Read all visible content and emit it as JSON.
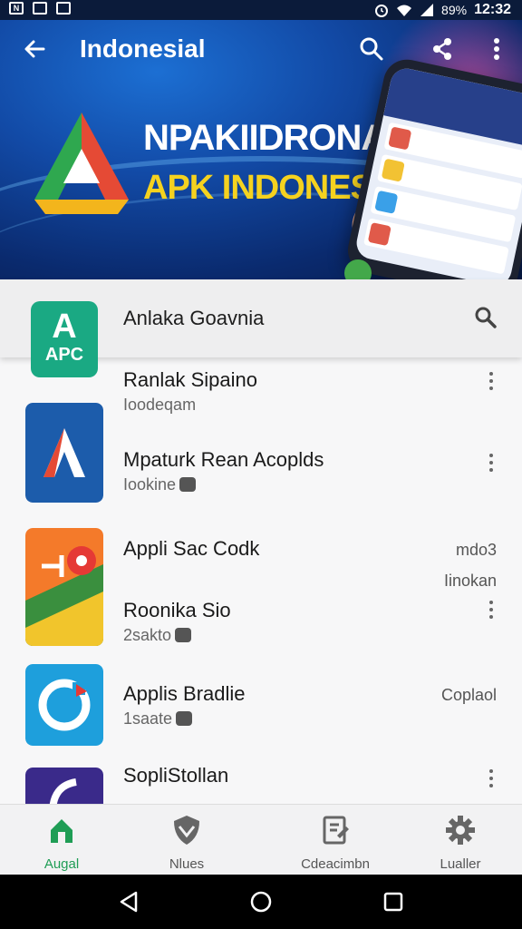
{
  "status_bar": {
    "time": "12:32",
    "battery": "89%"
  },
  "app_bar": {
    "title": "Indonesial",
    "back_icon": "arrow-left-icon",
    "actions": [
      "search-icon",
      "share-icon",
      "more-vertical-icon"
    ]
  },
  "hero": {
    "brand_line1": "NPAKIIDRONA",
    "brand_line2": "APK INDONESIA",
    "colors": {
      "brand_line2": "#f5d21f",
      "background": "#124aa6"
    }
  },
  "search": {
    "text": "Anlaka Goavnia",
    "icon": "search-icon"
  },
  "top_icon": {
    "letter": "A",
    "text": "APC",
    "color": "#1aa983"
  },
  "list": [
    {
      "title": "Ranlak Sipaino",
      "subtitle": "Ioodeqam"
    },
    {
      "title": "Mpaturk Rean Acoplds",
      "subtitle": "Iookine"
    },
    {
      "title": "Appli Sac Codk",
      "right": "mdo3"
    },
    {
      "title": "Roonika Sio",
      "subtitle": "2sakto",
      "right": "Iinokan"
    },
    {
      "title": "Applis Bradlie",
      "subtitle": "1saate",
      "right": "Coplaol"
    },
    {
      "title": "SopliStollan"
    }
  ],
  "bottom_nav": [
    {
      "label": "Augal",
      "icon": "home-icon",
      "active": true
    },
    {
      "label": "Nlues",
      "icon": "shield-icon",
      "active": false
    },
    {
      "label": "Cdeacimbn",
      "icon": "document-icon",
      "active": false
    },
    {
      "label": "Lualler",
      "icon": "gear-icon",
      "active": false
    }
  ]
}
